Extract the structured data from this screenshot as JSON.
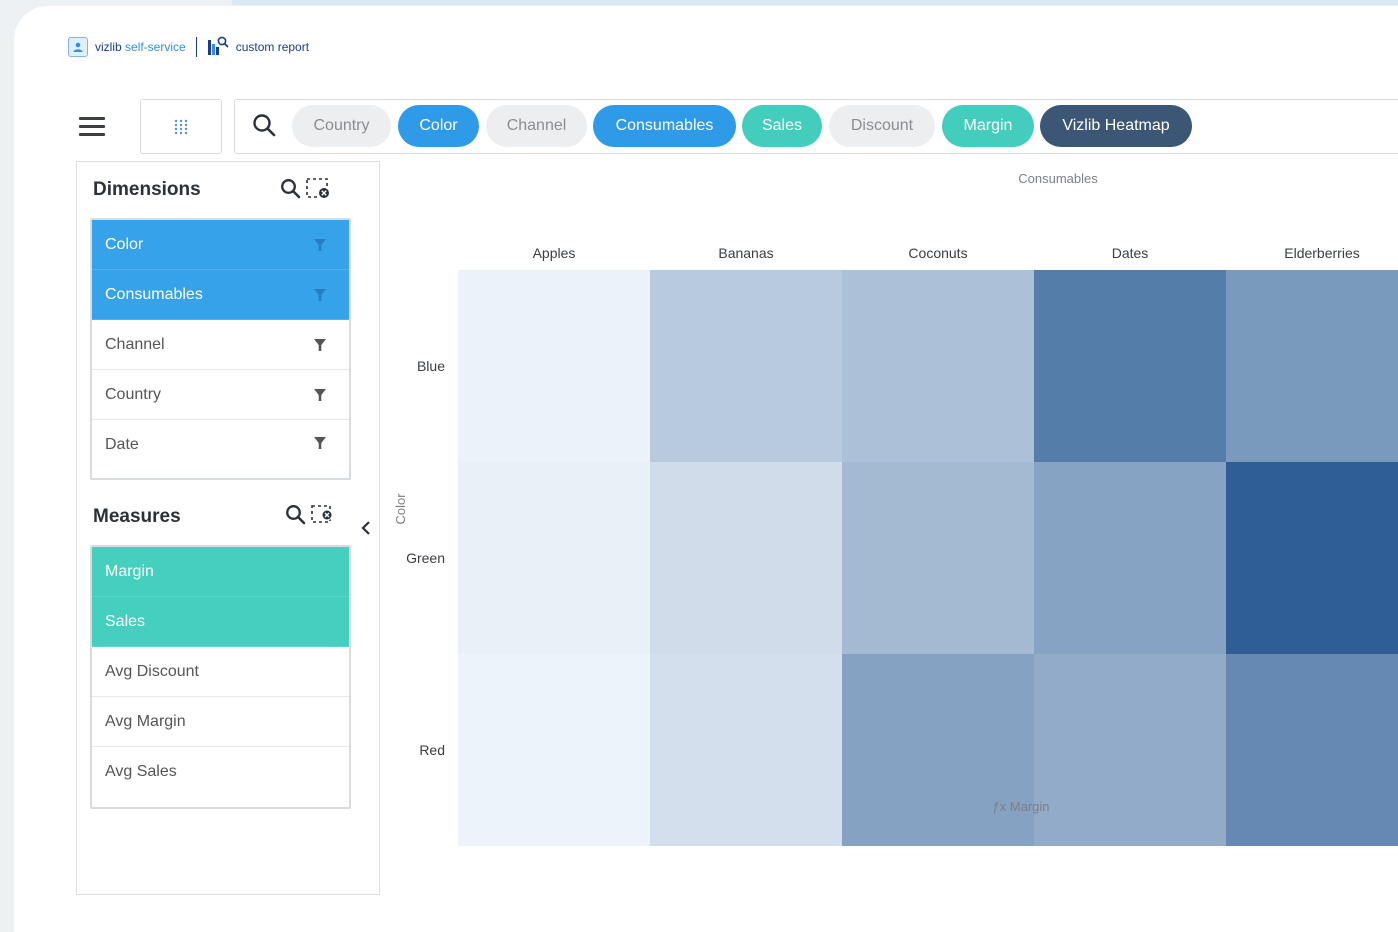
{
  "brand": {
    "app_part1": "vizlib ",
    "app_part2": "self-service",
    "report": "custom report"
  },
  "toolbar": {
    "menu_icon": "hamburger-menu-icon",
    "grid_icon": "grid-dots-icon",
    "search_icon": "search-icon",
    "pills": [
      {
        "label": "Country",
        "style": "gray"
      },
      {
        "label": "Color",
        "style": "blue"
      },
      {
        "label": "Channel",
        "style": "gray"
      },
      {
        "label": "Consumables",
        "style": "blue"
      },
      {
        "label": "Sales",
        "style": "teal"
      },
      {
        "label": "Discount",
        "style": "gray"
      },
      {
        "label": "Margin",
        "style": "teal"
      },
      {
        "label": "Vizlib Heatmap",
        "style": "navy"
      }
    ]
  },
  "dimensions": {
    "title": "Dimensions",
    "items": [
      {
        "label": "Color",
        "selected": true
      },
      {
        "label": "Consumables",
        "selected": true
      },
      {
        "label": "Channel",
        "selected": false
      },
      {
        "label": "Country",
        "selected": false
      },
      {
        "label": "Date",
        "selected": false
      }
    ]
  },
  "measures": {
    "title": "Measures",
    "items": [
      {
        "label": "Margin",
        "selected": true
      },
      {
        "label": "Sales",
        "selected": true
      },
      {
        "label": "Avg Discount",
        "selected": false
      },
      {
        "label": "Avg Margin",
        "selected": false
      },
      {
        "label": "Avg Sales",
        "selected": false
      }
    ]
  },
  "colors": {
    "accent_blue": "#2f9be8",
    "accent_teal": "#43cdbc",
    "accent_navy": "#3c5775"
  },
  "chart_data": {
    "type": "heatmap",
    "title": "",
    "xlabel": "Consumables",
    "ylabel": "Color",
    "x": [
      "Apples",
      "Bananas",
      "Coconuts",
      "Dates",
      "Elderberries"
    ],
    "y": [
      "Blue",
      "Green",
      "Red"
    ],
    "values": [
      [
        0.04,
        0.3,
        0.36,
        0.8,
        0.62
      ],
      [
        0.05,
        0.18,
        0.4,
        0.55,
        1.0
      ],
      [
        0.03,
        0.16,
        0.56,
        0.5,
        0.72
      ]
    ],
    "measure_label": "Margin",
    "color_low": "#f3f8fd",
    "color_high": "#2e5e95",
    "legend": "none"
  }
}
